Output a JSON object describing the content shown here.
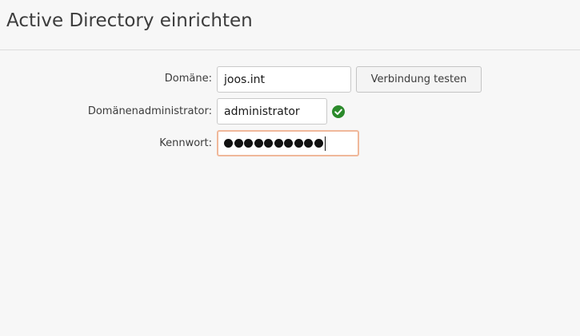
{
  "header": {
    "title": "Active Directory einrichten"
  },
  "form": {
    "domain": {
      "label": "Domäne:",
      "value": "joos.int",
      "test_button_label": "Verbindung testen"
    },
    "admin": {
      "label": "Domänenadministrator:",
      "value": "administrator",
      "status_icon": "check-circle-icon",
      "status_color": "#2b8a2b"
    },
    "password": {
      "label": "Kennwort:",
      "masked_length": 10,
      "focus_color": "#f0b89a"
    }
  }
}
